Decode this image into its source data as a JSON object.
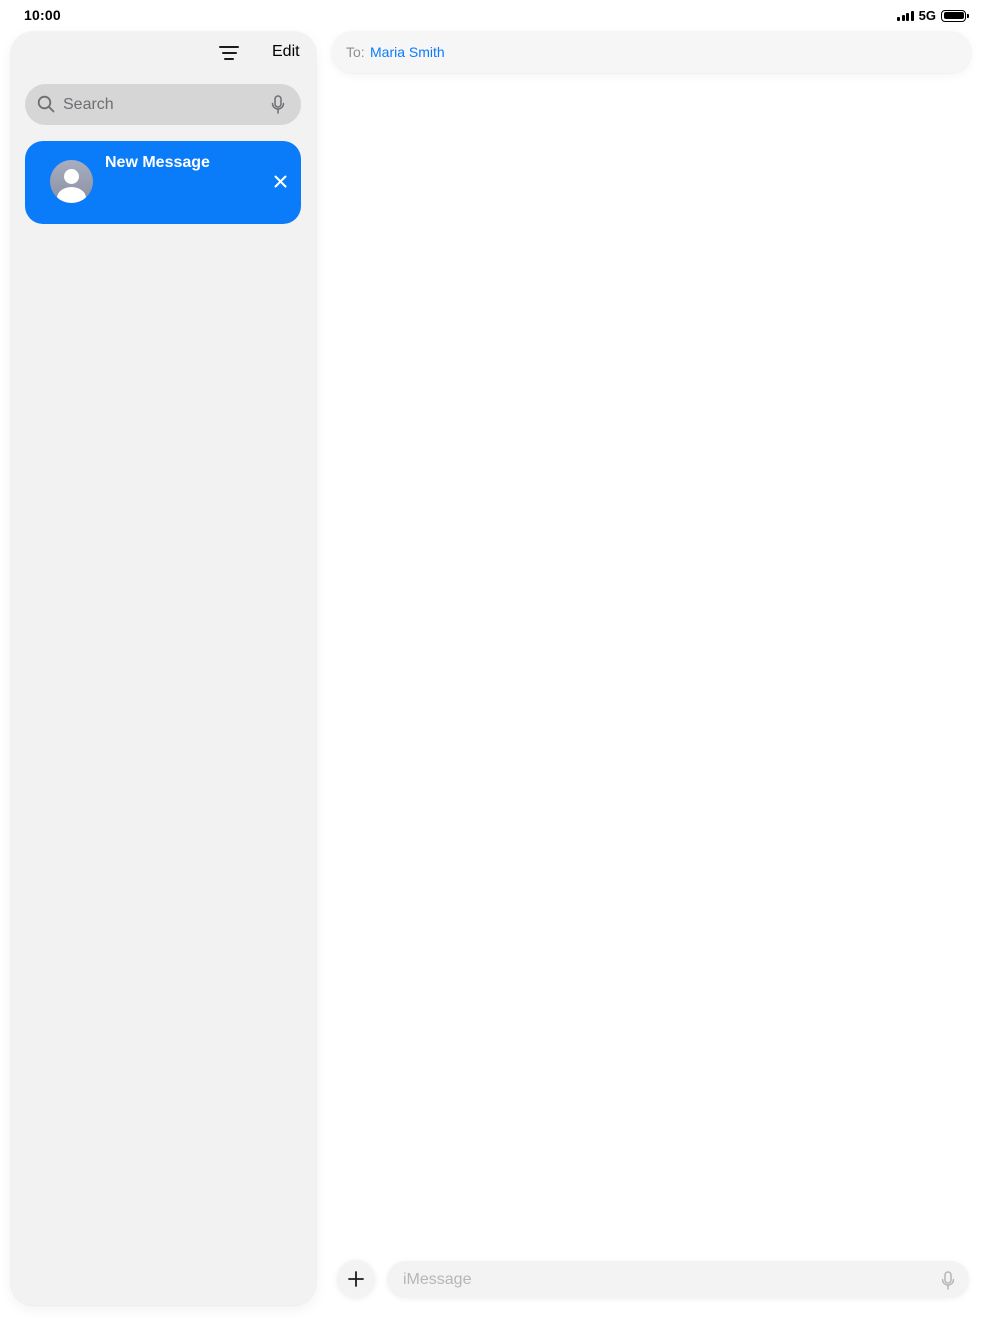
{
  "status_bar": {
    "time": "10:00",
    "network": "5G",
    "battery_level": 1.0,
    "signal_bars": 4
  },
  "sidebar": {
    "filter_icon": "filter-lines-icon",
    "edit_label": "Edit",
    "search": {
      "placeholder": "Search",
      "icon": "magnifying-glass-icon",
      "mic_icon": "microphone-icon"
    },
    "conversations": [
      {
        "title": "New Message",
        "avatar_icon": "person-silhouette-icon",
        "close_icon": "close-x-icon",
        "selected": true
      }
    ]
  },
  "main": {
    "to_label": "To:",
    "recipient": "Maria Smith",
    "composer": {
      "add_icon": "plus-icon",
      "placeholder": "iMessage",
      "mic_icon": "microphone-icon"
    }
  },
  "colors": {
    "accent": "#0a7cf9",
    "sidebar_bg": "#f2f2f2",
    "search_bg": "#d6d6d6"
  }
}
